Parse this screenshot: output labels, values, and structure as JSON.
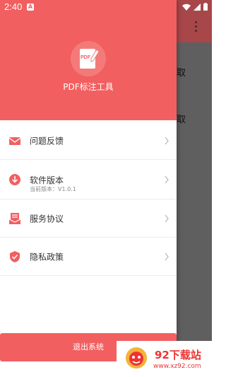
{
  "statusbar": {
    "time": "2:40",
    "indicator": "A"
  },
  "background": {
    "texts": [
      "取",
      "取"
    ]
  },
  "drawer": {
    "app_name": "PDF标注工具",
    "logo_text": "PDF",
    "items": [
      {
        "label": "问题反馈",
        "icon": "mail-icon"
      },
      {
        "label": "软件版本",
        "sub": "当前版本：V1.0.1",
        "icon": "download-icon"
      },
      {
        "label": "服务协议",
        "icon": "agreement-icon"
      },
      {
        "label": "隐私政策",
        "icon": "shield-check-icon"
      }
    ],
    "logout_label": "退出系统"
  },
  "watermark": {
    "title": "92下载站",
    "url": "www.xz92.com"
  },
  "colors": {
    "accent": "#f25f60",
    "header_bg": "#f25f60"
  }
}
